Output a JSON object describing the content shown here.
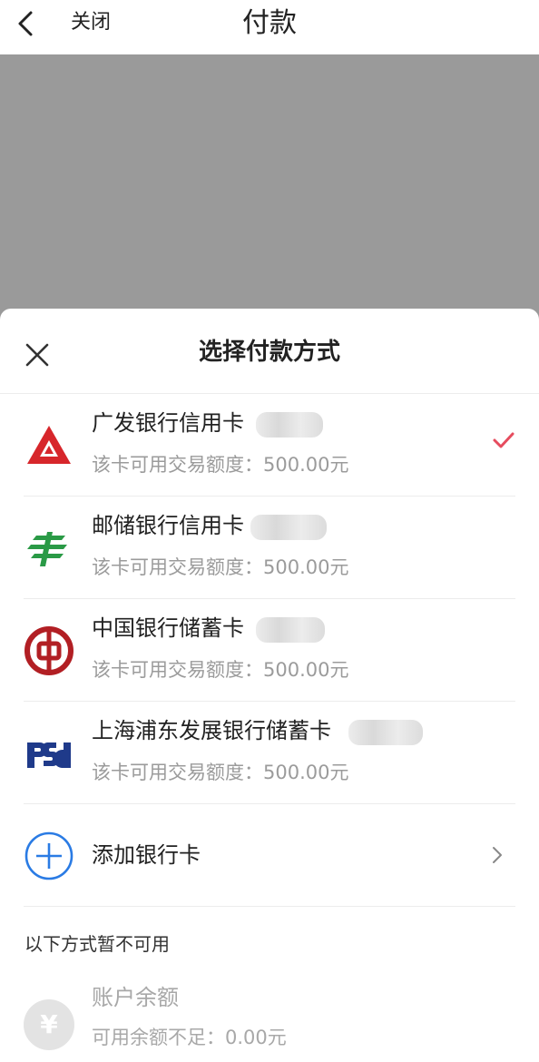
{
  "header": {
    "back_icon": "chevron-left-icon",
    "close_label": "关闭",
    "title": "付款"
  },
  "sheet": {
    "close_icon": "close-icon",
    "title": "选择付款方式",
    "cards": [
      {
        "name": "广发银行信用卡",
        "limit": "该卡可用交易额度：500.00元",
        "icon": "cgb-logo-icon",
        "selected": true
      },
      {
        "name": "邮储银行信用卡",
        "limit": "该卡可用交易额度：500.00元",
        "icon": "psbc-logo-icon",
        "selected": false
      },
      {
        "name": "中国银行储蓄卡",
        "limit": "该卡可用交易额度：500.00元",
        "icon": "boc-logo-icon",
        "selected": false
      },
      {
        "name": "上海浦东发展银行储蓄卡",
        "limit": "该卡可用交易额度：500.00元",
        "icon": "spdb-logo-icon",
        "selected": false
      }
    ],
    "add_card": {
      "label": "添加银行卡",
      "icon": "plus-circle-icon",
      "chevron": "chevron-right-icon"
    },
    "unavailable_title": "以下方式暂不可用",
    "balance": {
      "name": "账户余额",
      "note": "可用余额不足：0.00元",
      "icon_glyph": "¥"
    }
  },
  "colors": {
    "overlay": "#9a9a9a",
    "check": "#e64c5e",
    "add_blue": "#2a7be4",
    "cgb_red": "#d7262b",
    "psbc_green": "#2a9a46",
    "boc_red": "#b21f24",
    "spdb_navy": "#1f3a8a"
  }
}
